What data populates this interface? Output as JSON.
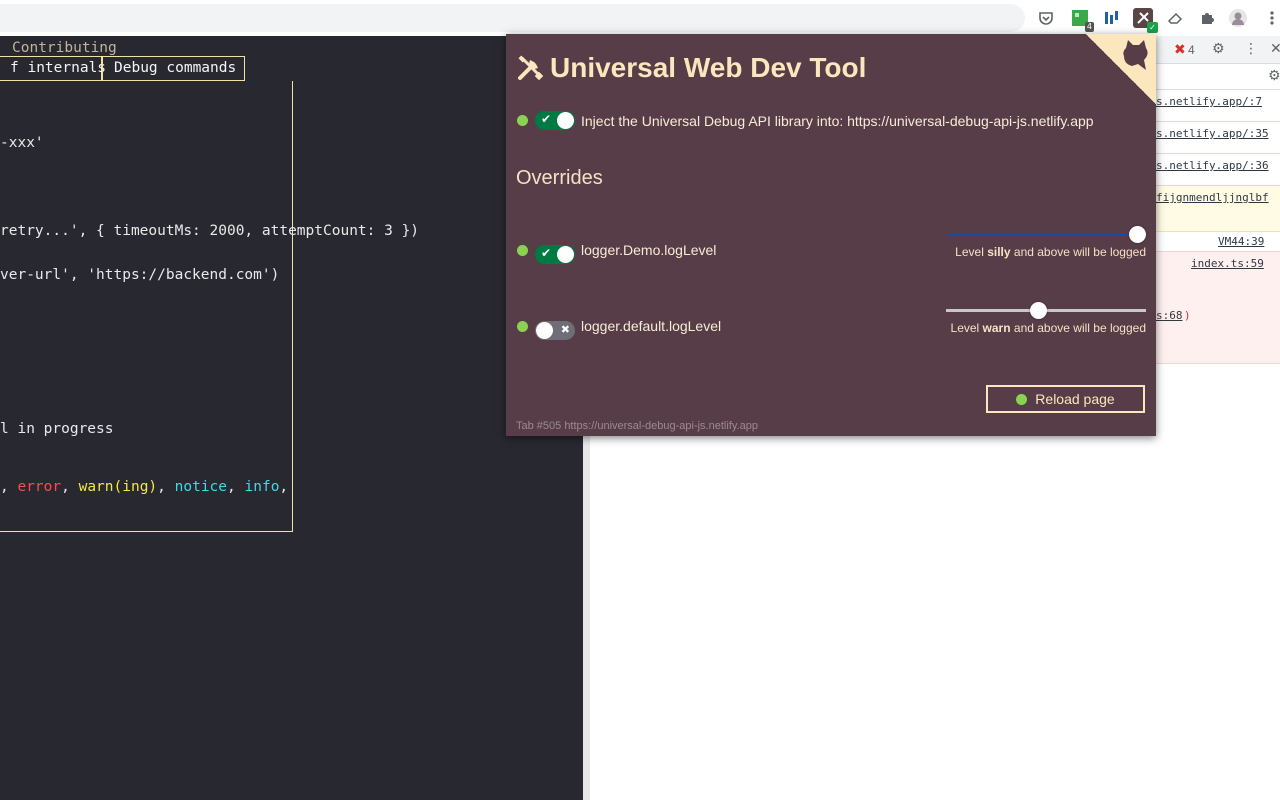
{
  "browser": {
    "extensions": [
      {
        "name": "pocket-icon",
        "glyph": "⛉"
      },
      {
        "name": "extension-green-icon",
        "glyph": "▦",
        "badge": "4"
      },
      {
        "name": "extension-bars-icon",
        "glyph": "⦀"
      },
      {
        "name": "universal-web-dev-tool-icon",
        "glyph": "⛏",
        "active": true
      },
      {
        "name": "extension-eraser-icon",
        "glyph": "⌫"
      },
      {
        "name": "puzzle-icon",
        "glyph": "✣"
      },
      {
        "name": "avatar-icon",
        "glyph": "☺"
      },
      {
        "name": "menu-kebab-icon",
        "glyph": "⋮"
      }
    ],
    "green_badge": "4"
  },
  "terminal": {
    "contributing_tab": "Contributing",
    "tab_internals": "f internals",
    "tab_debug_commands": "Debug commands",
    "line_xxx": "-xxx'",
    "line_retry": "retry...', { timeoutMs: 2000, attemptCount: 3 })",
    "line_server": "ver-url', 'https://backend.com')",
    "line_progress": "l in progress",
    "levels": {
      "sep0": ", ",
      "error": "error",
      "sep1": ", ",
      "warn": "warn(ing)",
      "sep2": ", ",
      "notice": "notice",
      "sep3": ", ",
      "info": "info",
      "sep4": ","
    }
  },
  "devtools": {
    "error_count": "4",
    "rows": [
      "s.netlify.app/:7",
      "s.netlify.app/:35",
      "s.netlify.app/:36",
      "fijgnmendljjnglbf",
      "VM44:39",
      "index.ts:59",
      "s:68"
    ],
    "close_paren": ")"
  },
  "popup": {
    "title": "Universal Web Dev Tool",
    "title_icon": "🛠",
    "inject_label": "Inject the Universal Debug API library into: https://universal-debug-api-js.netlify.app",
    "inject_enabled": true,
    "overrides_heading": "Overrides",
    "overrides": [
      {
        "key": "logger.Demo.logLevel",
        "enabled": true,
        "slider_fraction": 1.0,
        "level_prefix": "Level ",
        "level": "silly",
        "level_suffix": " and above will be logged"
      },
      {
        "key": "logger.default.logLevel",
        "enabled": false,
        "slider_fraction": 0.46,
        "level_prefix": "Level ",
        "level": "warn",
        "level_suffix": " and above will be logged"
      }
    ],
    "reload_label": "Reload page",
    "footer": "Tab #505 https://universal-debug-api-js.netlify.app",
    "colors": {
      "background": "#563d48",
      "accent": "#fce6bd",
      "status_dot": "#8bd253",
      "toggle_on": "#007a43",
      "slider_fill": "#1c4aa6"
    }
  }
}
